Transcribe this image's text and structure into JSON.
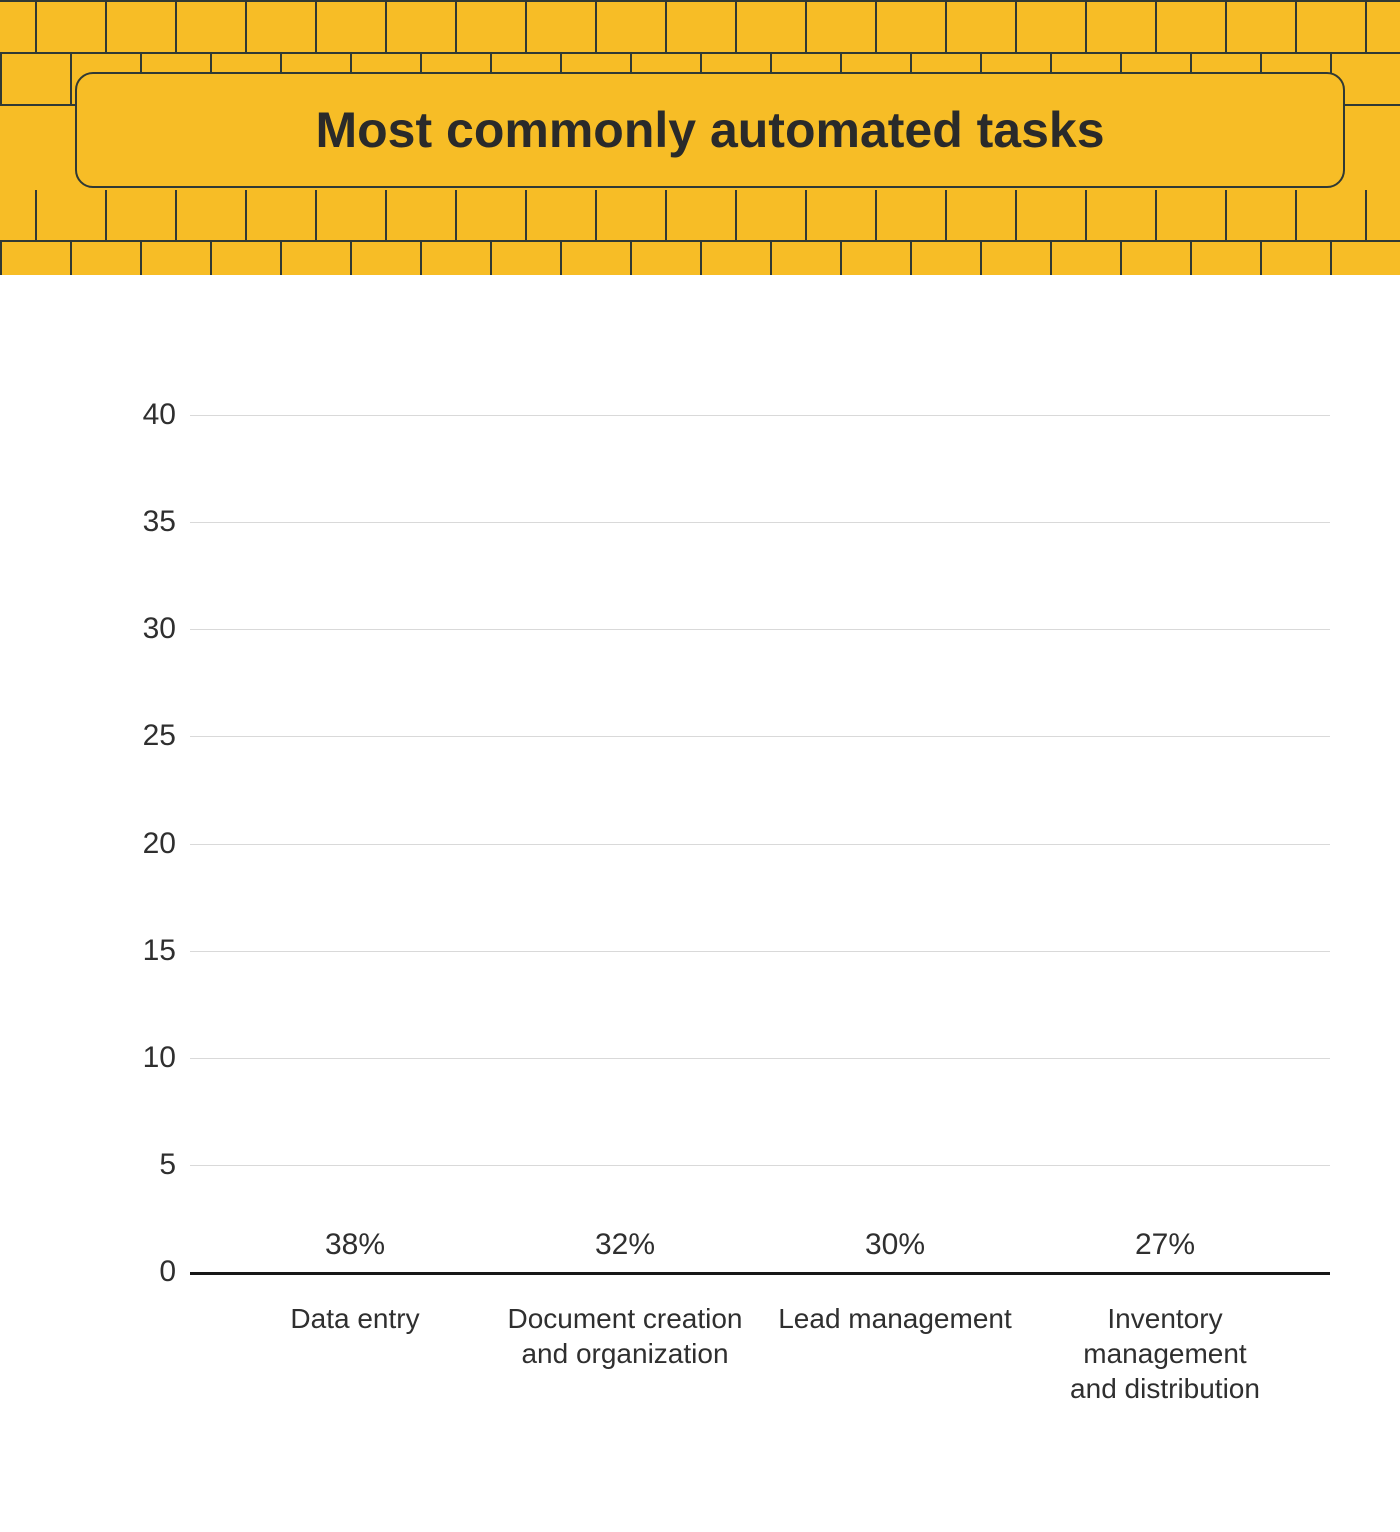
{
  "header": {
    "title": "Most commonly automated tasks"
  },
  "yticks": [
    "0",
    "5",
    "10",
    "15",
    "20",
    "25",
    "30",
    "35",
    "40"
  ],
  "chart_data": {
    "type": "bar",
    "title": "Most commonly automated tasks",
    "xlabel": "",
    "ylabel": "",
    "ylim": [
      0,
      40
    ],
    "categories": [
      "Data entry",
      "Document creation and organization",
      "Lead management",
      "Inventory management and distribution"
    ],
    "values": [
      38,
      32,
      30,
      27
    ],
    "value_labels": [
      "38%",
      "32%",
      "30%",
      "27%"
    ],
    "colors": [
      "#36b4e5",
      "#f99e80",
      "#f24405",
      "#f7bd26"
    ]
  }
}
